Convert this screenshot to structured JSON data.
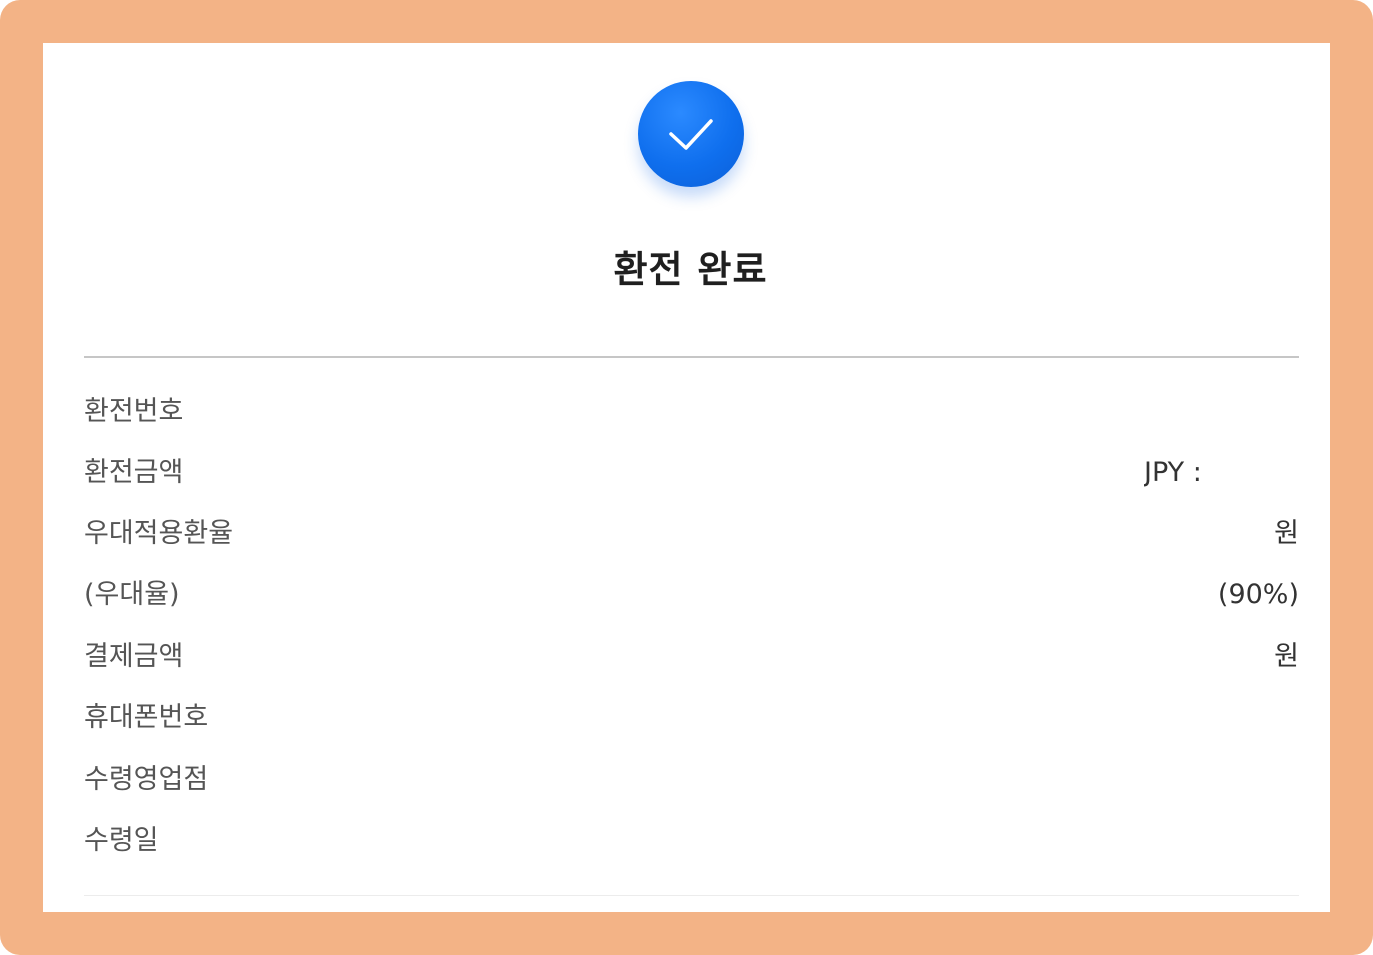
{
  "title": "환전 완료",
  "colors": {
    "frame": "#f3b386",
    "accent": "#0f6fee",
    "panel": "#ffffff"
  },
  "icon": "check-icon",
  "rows": [
    {
      "label": "환전번호",
      "value": ""
    },
    {
      "label": "환전금액",
      "value": "JPY :"
    },
    {
      "label": "우대적용환율",
      "value": "원"
    },
    {
      "label": "(우대율)",
      "value": "(90%)"
    },
    {
      "label": "결제금액",
      "value": "원"
    },
    {
      "label": "휴대폰번호",
      "value": ""
    },
    {
      "label": "수령영업점",
      "value": ""
    },
    {
      "label": "수령일",
      "value": ""
    }
  ]
}
